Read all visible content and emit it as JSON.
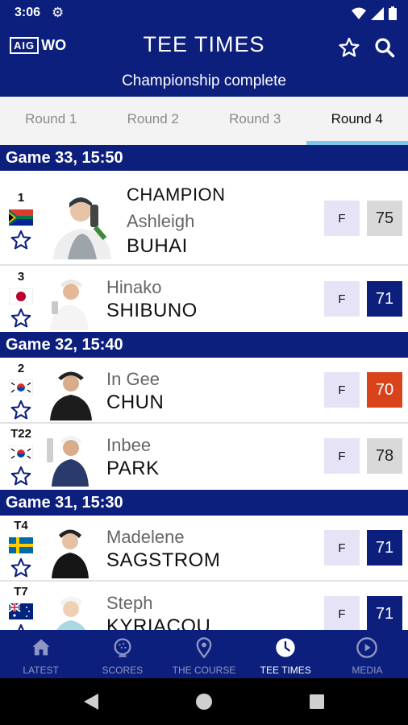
{
  "status": {
    "time": "3:06"
  },
  "header": {
    "logo_left": "AIG",
    "logo_right": "WO",
    "title": "TEE TIMES",
    "subtitle": "Championship complete"
  },
  "tabs": [
    {
      "label": "Round 1",
      "active": false
    },
    {
      "label": "Round 2",
      "active": false
    },
    {
      "label": "Round 3",
      "active": false
    },
    {
      "label": "Round 4",
      "active": true
    }
  ],
  "groups": [
    {
      "title": "Game 33, 15:50",
      "players": [
        {
          "pos": "1",
          "country": "south-africa",
          "tag": "CHAMPION",
          "first": "Ashleigh",
          "last": "BUHAI",
          "status": "F",
          "score": "75",
          "score_color": "#d9d9d9",
          "score_text": "#222222"
        },
        {
          "pos": "3",
          "country": "japan",
          "first": "Hinako",
          "last": "SHIBUNO",
          "status": "F",
          "score": "71",
          "score_color": "#0c1f7c",
          "score_text": "#ffffff"
        }
      ]
    },
    {
      "title": "Game 32, 15:40",
      "players": [
        {
          "pos": "2",
          "country": "south-korea",
          "first": "In Gee",
          "last": "CHUN",
          "status": "F",
          "score": "70",
          "score_color": "#d9431c",
          "score_text": "#ffffff"
        },
        {
          "pos": "T22",
          "country": "south-korea",
          "first": "Inbee",
          "last": "PARK",
          "status": "F",
          "score": "78",
          "score_color": "#d9d9d9",
          "score_text": "#222222"
        }
      ]
    },
    {
      "title": "Game 31, 15:30",
      "players": [
        {
          "pos": "T4",
          "country": "sweden",
          "first": "Madelene",
          "last": "SAGSTROM",
          "status": "F",
          "score": "71",
          "score_color": "#0c1f7c",
          "score_text": "#ffffff"
        },
        {
          "pos": "T7",
          "country": "australia",
          "first": "Steph",
          "last": "KYRIACOU",
          "status": "F",
          "score": "71",
          "score_color": "#0c1f7c",
          "score_text": "#ffffff"
        }
      ]
    }
  ],
  "bottom_nav": [
    {
      "label": "LATEST",
      "icon": "home-icon",
      "active": false
    },
    {
      "label": "SCORES",
      "icon": "golf-ball-icon",
      "active": false
    },
    {
      "label": "THE COURSE",
      "icon": "location-pin-icon",
      "active": false
    },
    {
      "label": "TEE TIMES",
      "icon": "clock-icon",
      "active": true
    },
    {
      "label": "MEDIA",
      "icon": "play-icon",
      "active": false
    }
  ],
  "colors": {
    "brand": "#0c1f7c",
    "tab_indicator": "#7fc4ea",
    "status_box": "#e7e3f7"
  }
}
